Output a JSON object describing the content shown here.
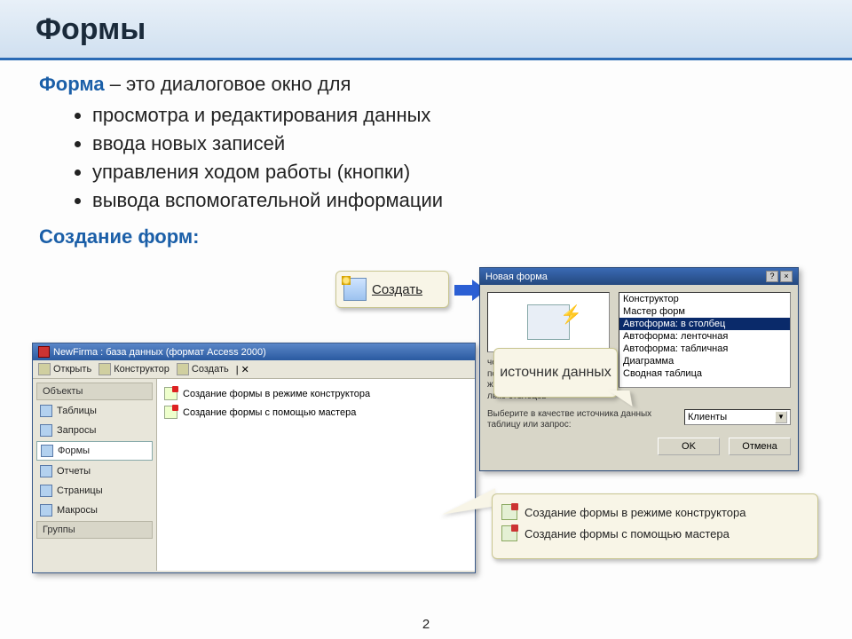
{
  "title": "Формы",
  "definition": {
    "term": "Форма",
    "rest": " – это диалоговое окно для"
  },
  "bullets": [
    "просмотра и редактирования данных",
    "ввода новых записей",
    "управления ходом работы (кнопки)",
    "вывода вспомогательной информации"
  ],
  "subhead": "Создание форм:",
  "create_btn": "Создать",
  "db_win": {
    "title": "NewFirma : база данных (формат Access 2000)",
    "tool_open": "Открыть",
    "tool_design": "Конструктор",
    "tool_create": "Создать",
    "cat_objects": "Объекты",
    "items": [
      "Таблицы",
      "Запросы",
      "Формы",
      "Отчеты",
      "Страницы",
      "Макросы"
    ],
    "cat_groups": "Группы",
    "rows": [
      "Создание формы в режиме конструктора",
      "Создание формы с помощью мастера"
    ]
  },
  "nf_win": {
    "title": "Новая форма",
    "options": [
      "Конструктор",
      "Мастер форм",
      "Автоформа: в столбец",
      "Автоформа: ленточная",
      "Автоформа: табличная",
      "Диаграмма",
      "Сводная таблица"
    ],
    "desc_lines": [
      "ческое создание",
      "полями,",
      "женными в один",
      "лько столбцов"
    ],
    "src_label": "Выберите в качестве источника данных таблицу или запрос:",
    "src_value": "Клиенты",
    "ok": "OK",
    "cancel": "Отмена",
    "help_btn": "?",
    "close_btn": "×"
  },
  "src_call": "источник данных",
  "opts_call": [
    "Создание формы в режиме конструктора",
    "Создание формы с помощью мастера"
  ],
  "page_number": "2"
}
